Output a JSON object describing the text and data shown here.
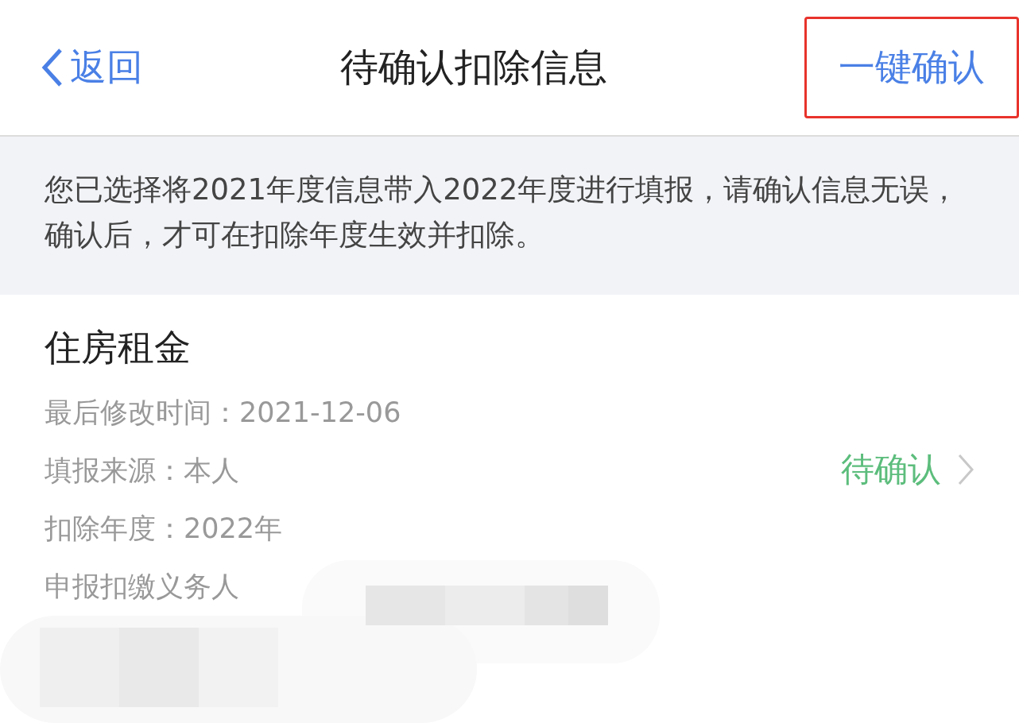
{
  "nav_bar": {
    "back": "返回",
    "title": "待确认扣除信息",
    "action": {
      "label": "一键确认",
      "highlighted": true
    }
  },
  "notice": "您已选择将2021年度信息带入2022年度进行填报，请确认信息无误，确认后，才可在扣除年度生效并扣除。",
  "records": [
    {
      "title": "住房租金",
      "details": [
        "最后修改时间：2021-12-06",
        "填报来源：本人",
        "扣除年度：2022年",
        "申报扣缴义务人"
      ],
      "status": "待确认"
    }
  ]
}
